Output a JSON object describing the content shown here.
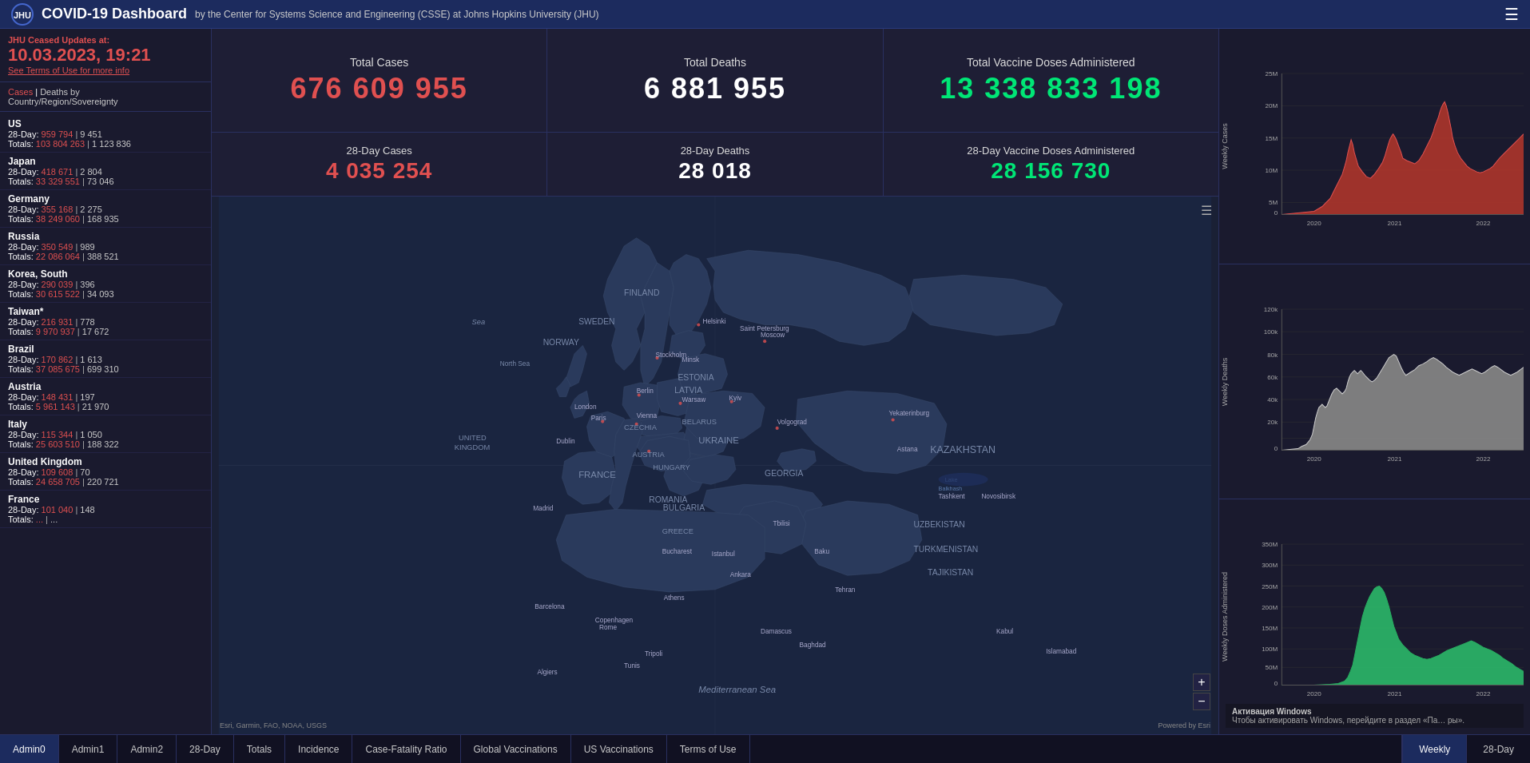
{
  "header": {
    "title": "COVID-19 Dashboard",
    "subtitle": "by the Center for Systems Science and Engineering (CSSE) at Johns Hopkins University (JHU)"
  },
  "sidebar": {
    "date_label": "JHU Ceased Updates at:",
    "date": "10.03.2023, 19:21",
    "terms_link": "See Terms of Use for more info",
    "filter_label": "Cases",
    "filter_sep": "|",
    "filter_label2": "Deaths by",
    "filter_sub": "Country/Region/Sovereignty",
    "countries": [
      {
        "name": "US",
        "day28_cases": "959 794",
        "day28_deaths": "9 451",
        "total_cases": "103 804 263",
        "total_deaths": "1 123 836"
      },
      {
        "name": "Japan",
        "day28_cases": "418 671",
        "day28_deaths": "2 804",
        "total_cases": "33 329 551",
        "total_deaths": "73 046"
      },
      {
        "name": "Germany",
        "day28_cases": "355 168",
        "day28_deaths": "2 275",
        "total_cases": "38 249 060",
        "total_deaths": "168 935"
      },
      {
        "name": "Russia",
        "day28_cases": "350 549",
        "day28_deaths": "989",
        "total_cases": "22 086 064",
        "total_deaths": "388 521"
      },
      {
        "name": "Korea, South",
        "day28_cases": "290 039",
        "day28_deaths": "396",
        "total_cases": "30 615 522",
        "total_deaths": "34 093"
      },
      {
        "name": "Taiwan*",
        "day28_cases": "216 931",
        "day28_deaths": "778",
        "total_cases": "9 970 937",
        "total_deaths": "17 672"
      },
      {
        "name": "Brazil",
        "day28_cases": "170 862",
        "day28_deaths": "1 613",
        "total_cases": "37 085 675",
        "total_deaths": "699 310"
      },
      {
        "name": "Austria",
        "day28_cases": "148 431",
        "day28_deaths": "197",
        "total_cases": "5 961 143",
        "total_deaths": "21 970"
      },
      {
        "name": "Italy",
        "day28_cases": "115 344",
        "day28_deaths": "1 050",
        "total_cases": "25 603 510",
        "total_deaths": "188 322"
      },
      {
        "name": "United Kingdom",
        "day28_cases": "109 608",
        "day28_deaths": "70",
        "total_cases": "24 658 705",
        "total_deaths": "220 721"
      },
      {
        "name": "France",
        "day28_cases": "101 040",
        "day28_deaths": "148",
        "total_cases": "...",
        "total_deaths": "..."
      }
    ]
  },
  "stats": {
    "total_cases_label": "Total Cases",
    "total_cases_value": "676 609 955",
    "total_deaths_label": "Total Deaths",
    "total_deaths_value": "6 881 955",
    "total_vaccine_label": "Total Vaccine Doses Administered",
    "total_vaccine_value": "13 338 833 198",
    "day28_cases_label": "28-Day Cases",
    "day28_cases_value": "4 035 254",
    "day28_deaths_label": "28-Day Deaths",
    "day28_deaths_value": "28 018",
    "day28_vaccine_label": "28-Day Vaccine Doses Administered",
    "day28_vaccine_value": "28 156 730"
  },
  "charts": {
    "weekly_cases_label": "Weekly Cases",
    "weekly_deaths_label": "Weekly Deaths",
    "weekly_vaccine_label": "Weekly Doses Administered",
    "x_ticks": [
      "2020",
      "2021",
      "2022"
    ],
    "cases_y_ticks": [
      "25M",
      "20M",
      "15M",
      "10M",
      "5M",
      "0"
    ],
    "deaths_y_ticks": [
      "120k",
      "100k",
      "80k",
      "60k",
      "40k",
      "20k",
      "0"
    ],
    "vaccine_y_ticks": [
      "350M",
      "300M",
      "250M",
      "200M",
      "150M",
      "100M",
      "50M",
      "0"
    ]
  },
  "map": {
    "attribution": "Esri, Garmin, FAO, NOAA, USGS",
    "powered": "Powered by Esri"
  },
  "bottom_bar": {
    "tabs_left": [
      "Admin0",
      "Admin1",
      "Admin2",
      "28-Day",
      "Totals",
      "Incidence",
      "Case-Fatality Ratio",
      "Global Vaccinations",
      "US Vaccinations",
      "Terms of Use"
    ],
    "tabs_right": [
      "Weekly",
      "28-Day"
    ]
  },
  "windows_activation": {
    "text": "Активация Windows",
    "subtext": "Чтобы активировать Windows, перейдите в раздел «Па… ры»."
  }
}
